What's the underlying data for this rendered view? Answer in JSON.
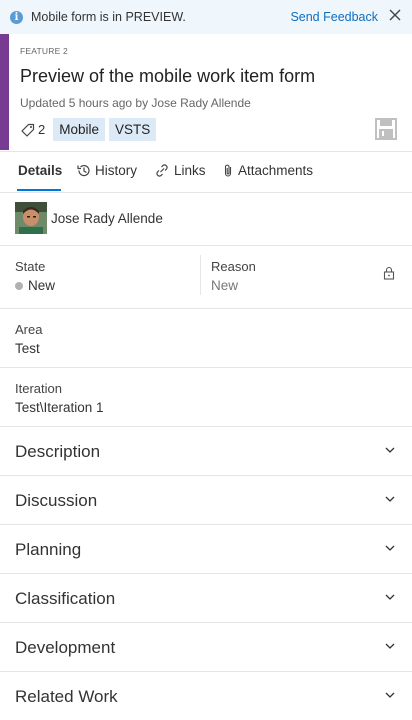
{
  "banner": {
    "message": "Mobile form is in PREVIEW.",
    "feedback_label": "Send Feedback"
  },
  "work_item": {
    "type": "FEATURE 2",
    "title": "Preview of the mobile work item form",
    "updated": "Updated 5 hours ago by Jose Rady Allende",
    "tag_count": "2",
    "tags": [
      "Mobile",
      "VSTS"
    ],
    "accent_color": "#773b93"
  },
  "tabs": [
    {
      "label": "Details",
      "icon": "none"
    },
    {
      "label": "History",
      "icon": "history-icon"
    },
    {
      "label": "Links",
      "icon": "link-icon"
    },
    {
      "label": "Attachments",
      "icon": "paperclip-icon"
    }
  ],
  "assigned_to": {
    "name": "Jose Rady Allende"
  },
  "fields": {
    "state": {
      "label": "State",
      "value": "New"
    },
    "reason": {
      "label": "Reason",
      "value": "New"
    },
    "area": {
      "label": "Area",
      "value": "Test"
    },
    "iteration": {
      "label": "Iteration",
      "value": "Test\\Iteration 1"
    }
  },
  "sections": [
    "Description",
    "Discussion",
    "Planning",
    "Classification",
    "Development",
    "Related Work"
  ]
}
